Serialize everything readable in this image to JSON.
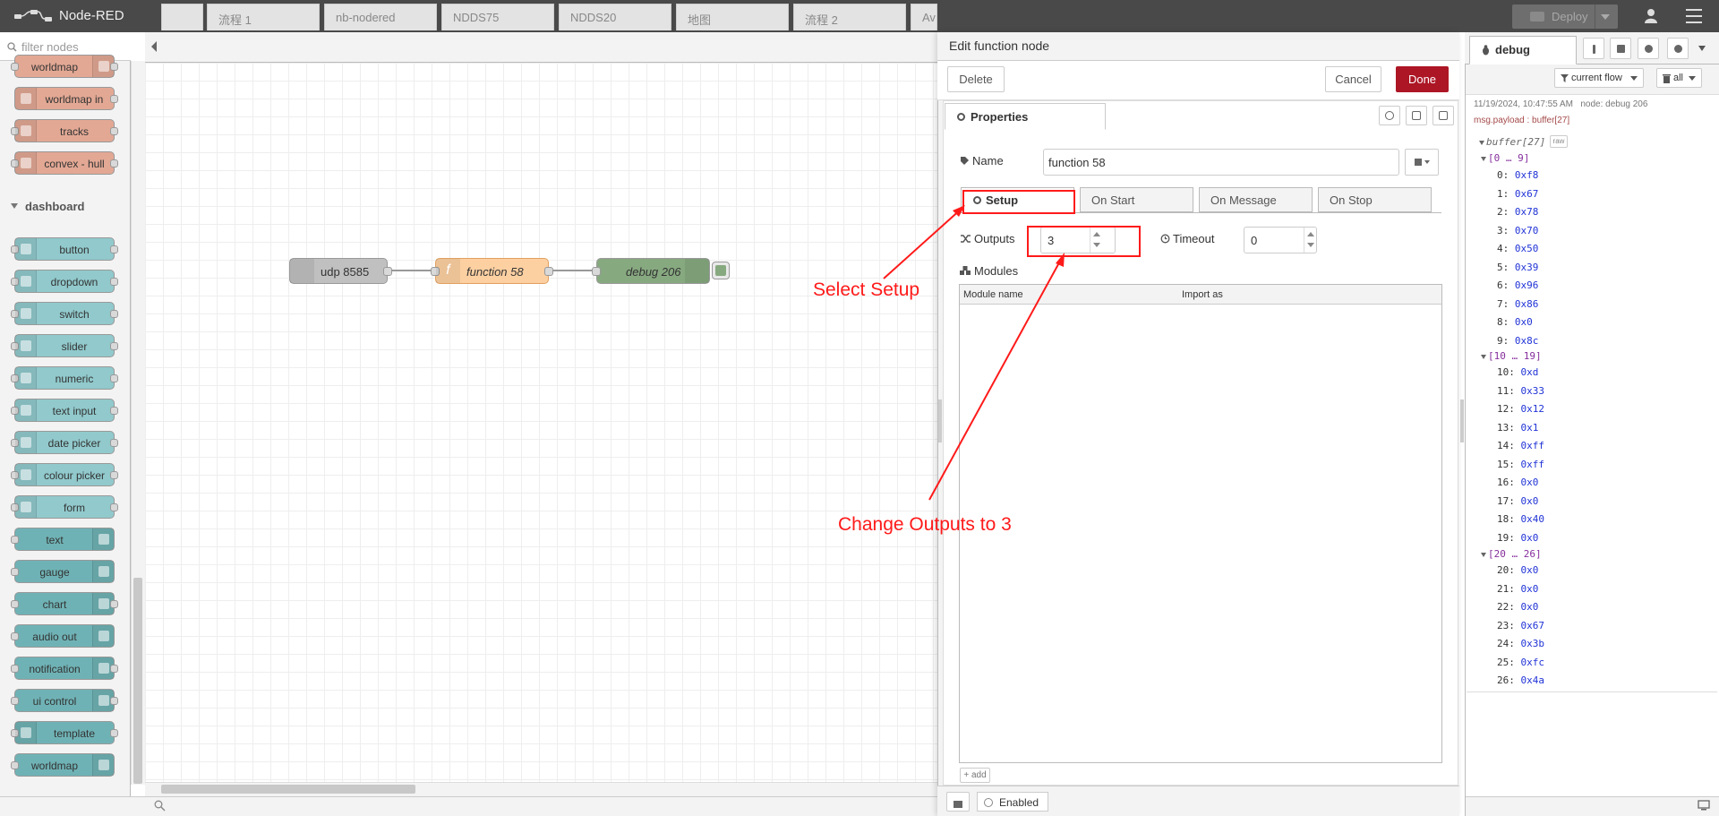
{
  "header": {
    "app_title": "Node-RED",
    "deploy_label": "Deploy"
  },
  "palette": {
    "filter_placeholder": "filter nodes",
    "category": "dashboard",
    "top_nodes": [
      "worldmap",
      "worldmap in",
      "tracks",
      "convex - hull"
    ],
    "dashboard_nodes": [
      "button",
      "dropdown",
      "switch",
      "slider",
      "numeric",
      "text input",
      "date picker",
      "colour picker",
      "form",
      "text",
      "gauge",
      "chart",
      "audio out",
      "notification",
      "ui control",
      "template",
      "worldmap"
    ]
  },
  "workspace": {
    "tabs": [
      "",
      "流程 1",
      "nb-nodered",
      "NDDS75",
      "NDDS20",
      "地图",
      "流程 2",
      "Av"
    ],
    "nodes": {
      "udp": "udp 8585",
      "function": "function 58",
      "debug": "debug 206"
    }
  },
  "annotations": {
    "select_setup": "Select Setup",
    "change_outputs": "Change Outputs to 3"
  },
  "editor": {
    "title": "Edit function node",
    "delete_label": "Delete",
    "cancel_label": "Cancel",
    "done_label": "Done",
    "properties_tab": "Properties",
    "name_label": "Name",
    "name_value": "function 58",
    "inner_tabs": [
      "Setup",
      "On Start",
      "On Message",
      "On Stop"
    ],
    "outputs_label": "Outputs",
    "outputs_value": "3",
    "timeout_label": "Timeout",
    "timeout_value": "0",
    "modules_label": "Modules",
    "module_col1": "Module name",
    "module_col2": "Import as",
    "add_label": "add",
    "enabled_label": "Enabled"
  },
  "debug": {
    "tab_label": "debug",
    "filter_flow": "current flow",
    "clear_label": "all",
    "timestamp": "11/19/2024, 10:47:55 AM",
    "node": "node: debug 206",
    "topic": "msg.payload : buffer[27]",
    "root": "buffer[27]",
    "raw": "raw",
    "groups": [
      "[0 … 9]",
      "[10 … 19]",
      "[20 … 26]"
    ],
    "rows": [
      {
        "k": "0:",
        "v": "0xf8"
      },
      {
        "k": "1:",
        "v": "0x67"
      },
      {
        "k": "2:",
        "v": "0x78"
      },
      {
        "k": "3:",
        "v": "0x70"
      },
      {
        "k": "4:",
        "v": "0x50"
      },
      {
        "k": "5:",
        "v": "0x39"
      },
      {
        "k": "6:",
        "v": "0x96"
      },
      {
        "k": "7:",
        "v": "0x86"
      },
      {
        "k": "8:",
        "v": "0x0"
      },
      {
        "k": "9:",
        "v": "0x8c"
      },
      {
        "k": "10:",
        "v": "0xd"
      },
      {
        "k": "11:",
        "v": "0x33"
      },
      {
        "k": "12:",
        "v": "0x12"
      },
      {
        "k": "13:",
        "v": "0x1"
      },
      {
        "k": "14:",
        "v": "0xff"
      },
      {
        "k": "15:",
        "v": "0xff"
      },
      {
        "k": "16:",
        "v": "0x0"
      },
      {
        "k": "17:",
        "v": "0x0"
      },
      {
        "k": "18:",
        "v": "0x40"
      },
      {
        "k": "19:",
        "v": "0x0"
      },
      {
        "k": "20:",
        "v": "0x0"
      },
      {
        "k": "21:",
        "v": "0x0"
      },
      {
        "k": "22:",
        "v": "0x0"
      },
      {
        "k": "23:",
        "v": "0x67"
      },
      {
        "k": "24:",
        "v": "0x3b"
      },
      {
        "k": "25:",
        "v": "0xfc"
      },
      {
        "k": "26:",
        "v": "0x4a"
      }
    ]
  },
  "colors": {
    "header": "#494949",
    "done": "#ad1625",
    "annotation": "#ff1a1a",
    "function_node": "#fdd0a2",
    "debug_node": "#87a980"
  }
}
